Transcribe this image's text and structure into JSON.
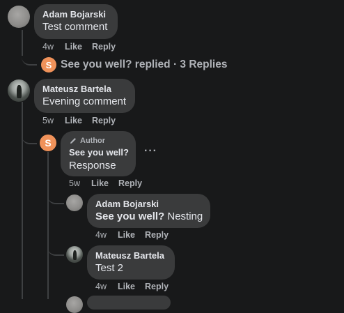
{
  "comments": [
    {
      "author": "Adam Bojarski",
      "text": "Test comment",
      "time": "4w",
      "like": "Like",
      "reply": "Reply",
      "replies_summary": {
        "avatar_letter": "S",
        "text": "See you well? replied · 3 Replies"
      }
    },
    {
      "author": "Mateusz Bartela",
      "text": "Evening comment",
      "time": "5w",
      "like": "Like",
      "reply": "Reply",
      "reply_thread": {
        "avatar_letter": "S",
        "badge": "Author",
        "author": "See you well?",
        "text": "Response",
        "time": "5w",
        "like": "Like",
        "reply": "Reply",
        "more": "···",
        "nested": [
          {
            "author": "Adam Bojarski",
            "mention": "See you well?",
            "text": " Nesting",
            "time": "4w",
            "like": "Like",
            "reply": "Reply"
          },
          {
            "author": "Mateusz Bartela",
            "text": "Test 2",
            "time": "4w",
            "like": "Like",
            "reply": "Reply"
          }
        ]
      }
    }
  ]
}
